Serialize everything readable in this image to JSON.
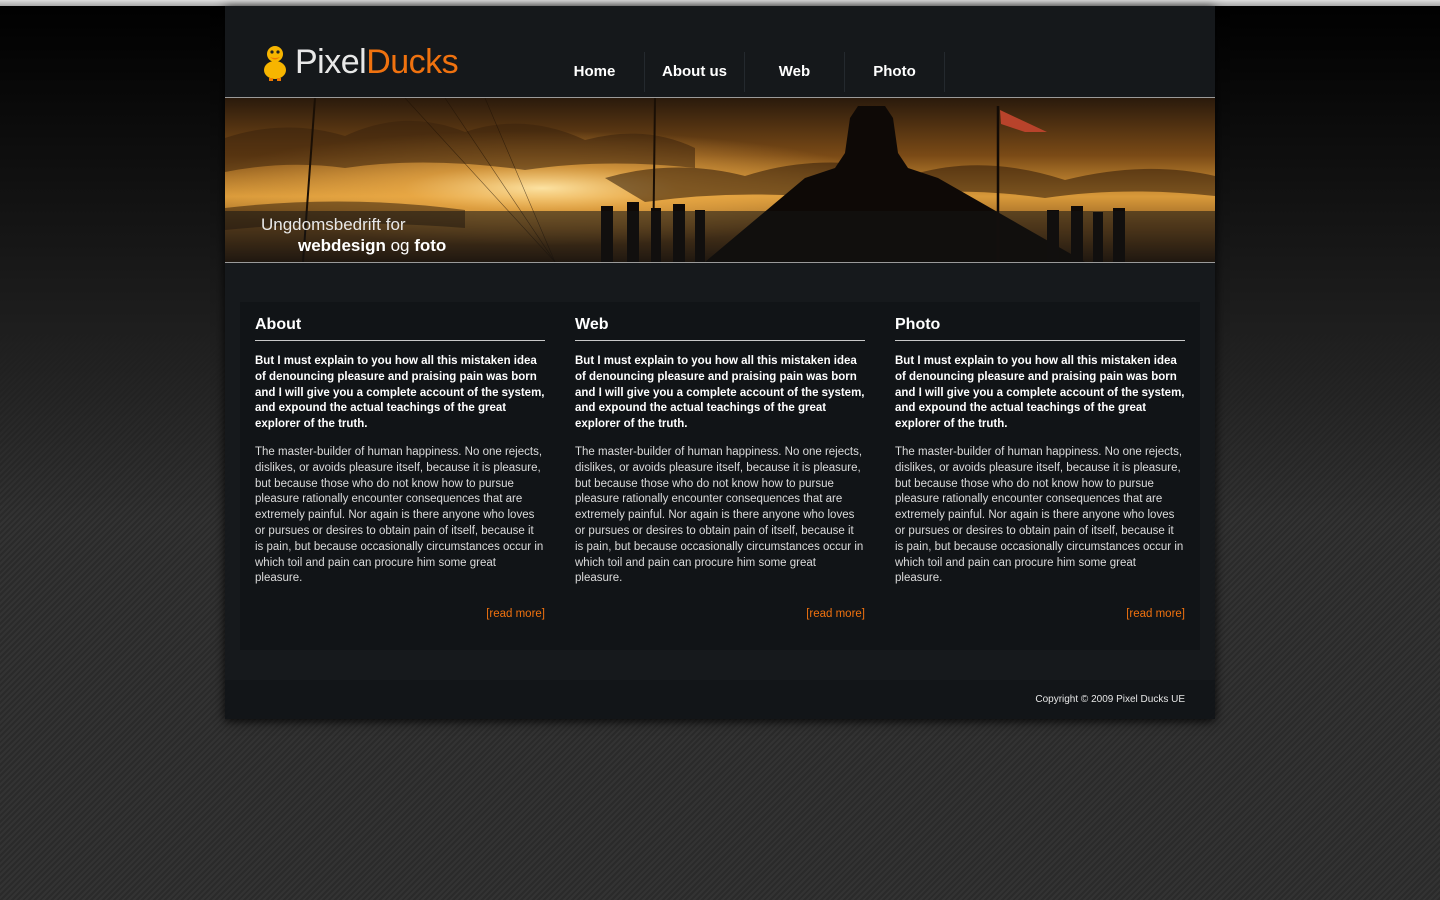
{
  "header": {
    "logo_part1": "Pixel",
    "logo_part2": "Ducks",
    "nav": [
      {
        "label": "Home"
      },
      {
        "label": "About us"
      },
      {
        "label": "Web"
      },
      {
        "label": "Photo"
      }
    ]
  },
  "hero": {
    "line1": "Ungdomsbedrift for",
    "line2_bold1": "webdesign",
    "line2_mid": " og ",
    "line2_bold2": "foto"
  },
  "columns": [
    {
      "title": "About",
      "lead": "But I must explain to you how all this mistaken idea of denouncing pleasure and praising pain was born and I will give you a complete account of the system, and expound the actual teachings of the great explorer of the truth.",
      "body": "The master-builder of human happiness. No one rejects, dislikes, or avoids pleasure itself, because it is pleasure, but because those who do not know how to pursue pleasure rationally encounter consequences that are extremely painful. Nor again is there anyone who loves or pursues or desires to obtain pain of itself, because it is pain, but because occasionally circumstances occur in which toil and pain can procure him some great pleasure.",
      "more": "[read more]"
    },
    {
      "title": "Web",
      "lead": "But I must explain to you how all this mistaken idea of denouncing pleasure and praising pain was born and I will give you a complete account of the system, and expound the actual teachings of the great explorer of the truth.",
      "body": "The master-builder of human happiness. No one rejects, dislikes, or avoids pleasure itself, because it is pleasure, but because those who do not know how to pursue pleasure rationally encounter consequences that are extremely painful. Nor again is there anyone who loves or pursues or desires to obtain pain of itself, because it is pain, but because occasionally circumstances occur in which toil and pain can procure him some great pleasure.",
      "more": "[read more]"
    },
    {
      "title": "Photo",
      "lead": "But I must explain to you how all this mistaken idea of denouncing pleasure and praising pain was born and I will give you a complete account of the system, and expound the actual teachings of the great explorer of the truth.",
      "body": "The master-builder of human happiness. No one rejects, dislikes, or avoids pleasure itself, because it is pleasure, but because those who do not know how to pursue pleasure rationally encounter consequences that are extremely painful. Nor again is there anyone who loves or pursues or desires to obtain pain of itself, because it is pain, but because occasionally circumstances occur in which toil and pain can procure him some great pleasure.",
      "more": "[read more]"
    }
  ],
  "footer": {
    "copyright": "Copyright © 2009 Pixel Ducks UE"
  },
  "colors": {
    "accent": "#f0720f",
    "page_bg": "#16191c",
    "column_bg": "#111417"
  },
  "icons": {
    "logo": "duck-icon"
  }
}
